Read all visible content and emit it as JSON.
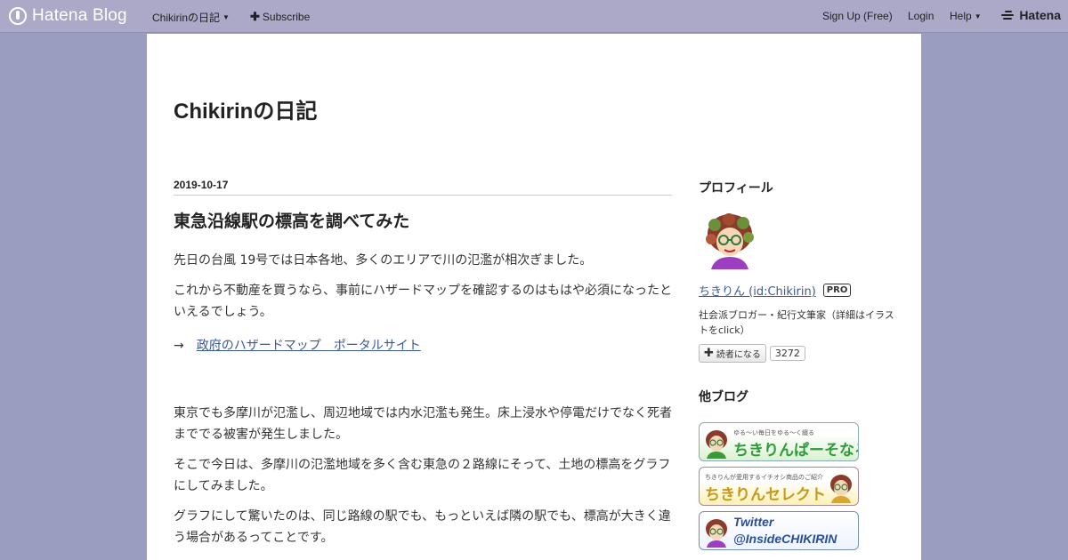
{
  "topbar": {
    "brand": "Hatena Blog",
    "blog_menu": "Chikirinの日記",
    "subscribe": "Subscribe",
    "signup": "Sign Up (Free)",
    "login": "Login",
    "help": "Help",
    "hatena": "Hatena"
  },
  "blog": {
    "title": "Chikirinの日記"
  },
  "entry": {
    "date": "2019-10-17",
    "title": "東急沿線駅の標高を調べてみた",
    "p1": "先日の台風 19号では日本各地、多くのエリアで川の氾濫が相次ぎました。",
    "p2": "これから不動産を買うなら、事前にハザードマップを確認するのはもはや必須になったといえるでしょう。",
    "arrow": "→",
    "link": "政府のハザードマップ　ポータルサイト",
    "p3": "東京でも多摩川が氾濫し、周辺地域では内水氾濫も発生。床上浸水や停電だけでなく死者まででる被害が発生しました。",
    "p4": "そこで今日は、多摩川の氾濫地域を多く含む東急の２路線にそって、土地の標高をグラフにしてみました。",
    "p5": "グラフにして驚いたのは、同じ路線の駅でも、もっといえば隣の駅でも、標高が大きく違う場合があるってことです。"
  },
  "sidebar": {
    "profile_heading": "プロフィール",
    "profile_name": "ちきりん (id:Chikirin)",
    "pro_badge": "PRO",
    "profile_desc": "社会派ブロガー・紀行文筆家（詳細はイラストをclick）",
    "reader_button": "読者になる",
    "reader_count": "3272",
    "other_heading": "他ブログ",
    "banners": [
      {
        "small": "ゆる〜い毎日をゆる〜く綴る",
        "big": "ちきりんぱーそなる"
      },
      {
        "small": "ちきりんが愛用するイチオシ商品のご紹介",
        "big": "ちきりんセレクト"
      },
      {
        "big": "Twitter\n@InsideCHIKIRIN"
      }
    ]
  },
  "colors": {
    "background": "#9a9cc0",
    "topbar": "#aba8c8",
    "link": "#3b5998"
  }
}
